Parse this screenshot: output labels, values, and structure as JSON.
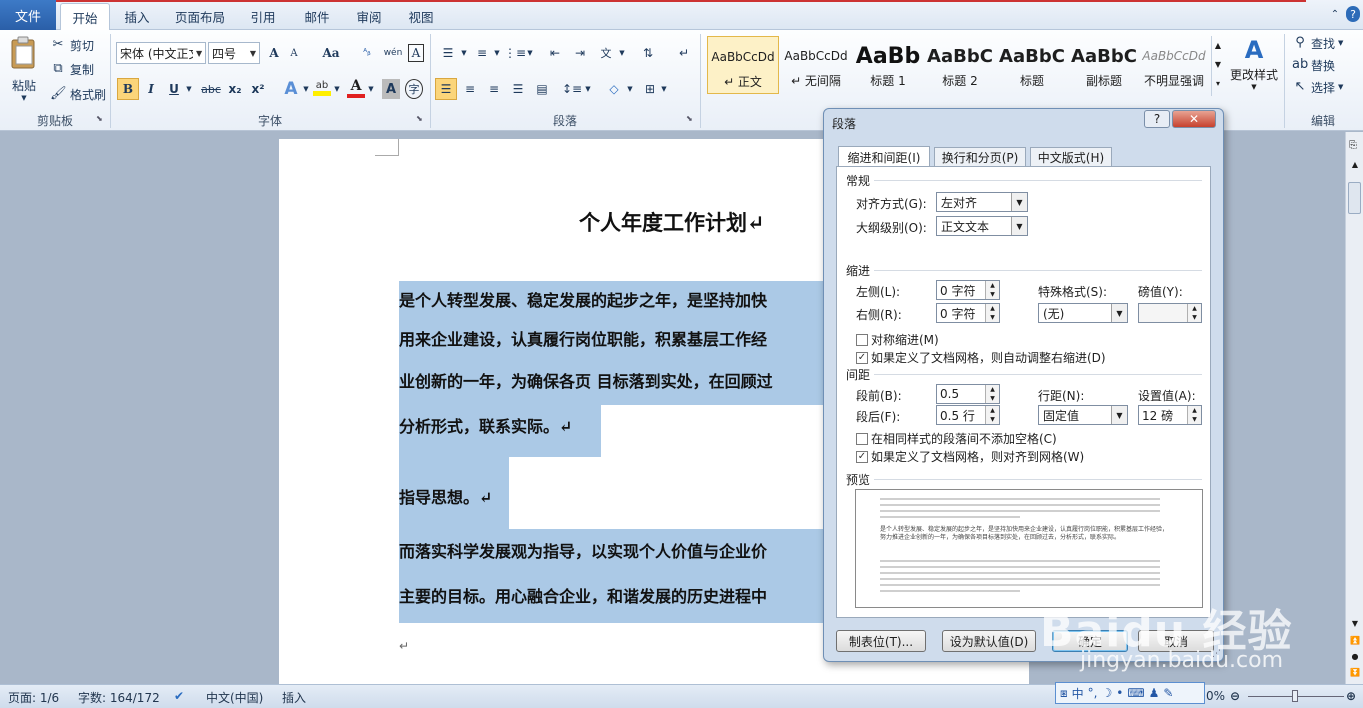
{
  "tabs": {
    "file": "文件",
    "home": "开始",
    "insert": "插入",
    "layout": "页面布局",
    "references": "引用",
    "mailings": "邮件",
    "review": "审阅",
    "view": "视图"
  },
  "clipboard": {
    "paste": "粘贴",
    "cut": "剪切",
    "copy": "复制",
    "format_painter": "格式刷",
    "label": "剪贴板"
  },
  "font": {
    "name": "宋体 (中文正文)",
    "size": "四号",
    "label": "字体",
    "bold": "B",
    "italic": "I",
    "underline": "U",
    "strike": "abc",
    "sub": "x₂",
    "sup": "x²",
    "grow": "A",
    "shrink": "A",
    "aa": "Aa",
    "phonetic": "wén",
    "a_box": "A"
  },
  "paragraph": {
    "label": "段落"
  },
  "styles": {
    "items": [
      {
        "sample": "AaBbCcDd",
        "name": "↵ 正文"
      },
      {
        "sample": "AaBbCcDd",
        "name": "↵ 无间隔"
      },
      {
        "sample": "AaBb",
        "name": "标题 1"
      },
      {
        "sample": "AaBbC",
        "name": "标题 2"
      },
      {
        "sample": "AaBbC",
        "name": "标题"
      },
      {
        "sample": "AaBbC",
        "name": "副标题"
      },
      {
        "sample": "AaBbCcDd",
        "name": "不明显强调"
      }
    ],
    "change": "更改样式"
  },
  "editing": {
    "find": "查找",
    "replace": "替换",
    "select": "选择",
    "label": "编辑"
  },
  "document": {
    "title": "个人年度工作计划↵",
    "lines": [
      "是个人转型发展、稳定发展的起步之年，是坚持加快",
      "用来企业建设，认真履行岗位职能，积累基层工作经",
      "业创新的一年，为确保各页  目标落到实处，在回顾过",
      "分析形式，联系实际。↵",
      "指导思想。↵",
      "而落实科学发展观为指导，以实现个人价值与企业价",
      "主要的目标。用心融合企业，和谐发展的历史进程中"
    ],
    "end_mark": "↵"
  },
  "dialog": {
    "title": "段落",
    "help": "?",
    "close": "✕",
    "tabs": [
      "缩进和间距(I)",
      "换行和分页(P)",
      "中文版式(H)"
    ],
    "general": {
      "heading": "常规",
      "alignment_label": "对齐方式(G):",
      "alignment_value": "左对齐",
      "outline_label": "大纲级别(O):",
      "outline_value": "正文文本"
    },
    "indent": {
      "heading": "缩进",
      "left_label": "左侧(L):",
      "left_value": "0 字符",
      "right_label": "右侧(R):",
      "right_value": "0 字符",
      "special_label": "特殊格式(S):",
      "special_value": "(无)",
      "by_label": "磅值(Y):",
      "by_value": "",
      "mirror": "对称缩进(M)",
      "auto_adjust": "如果定义了文档网格，则自动调整右缩进(D)"
    },
    "spacing": {
      "heading": "间距",
      "before_label": "段前(B):",
      "before_value": "0.5",
      "after_label": "段后(F):",
      "after_value": "0.5 行",
      "line_label": "行距(N):",
      "line_value": "固定值",
      "at_label": "设置值(A):",
      "at_value": "12 磅",
      "no_space": "在相同样式的段落间不添加空格(C)",
      "snap_grid": "如果定义了文档网格，则对齐到网格(W)"
    },
    "preview_heading": "预览",
    "preview_text": "是个人转型发展、稳定发展的起步之年，是坚持加快用来企业建设，认真履行岗位职能，积累基层工作经验，努力推进企业创新的一年，为确保各项目标落到实处，在回顾过去，分析形式，联系实际。",
    "buttons": {
      "tabs": "制表位(T)...",
      "default": "设为默认值(D)",
      "ok": "确定",
      "cancel": "取消"
    }
  },
  "status": {
    "page": "页面: 1/6",
    "words": "字数: 164/172",
    "language": "中文(中国)",
    "mode": "插入",
    "zoom": "0%"
  },
  "ime": {
    "mode": "中"
  },
  "watermark": {
    "brand": "Baidu 经验",
    "url": "jingyan.baidu.com"
  }
}
